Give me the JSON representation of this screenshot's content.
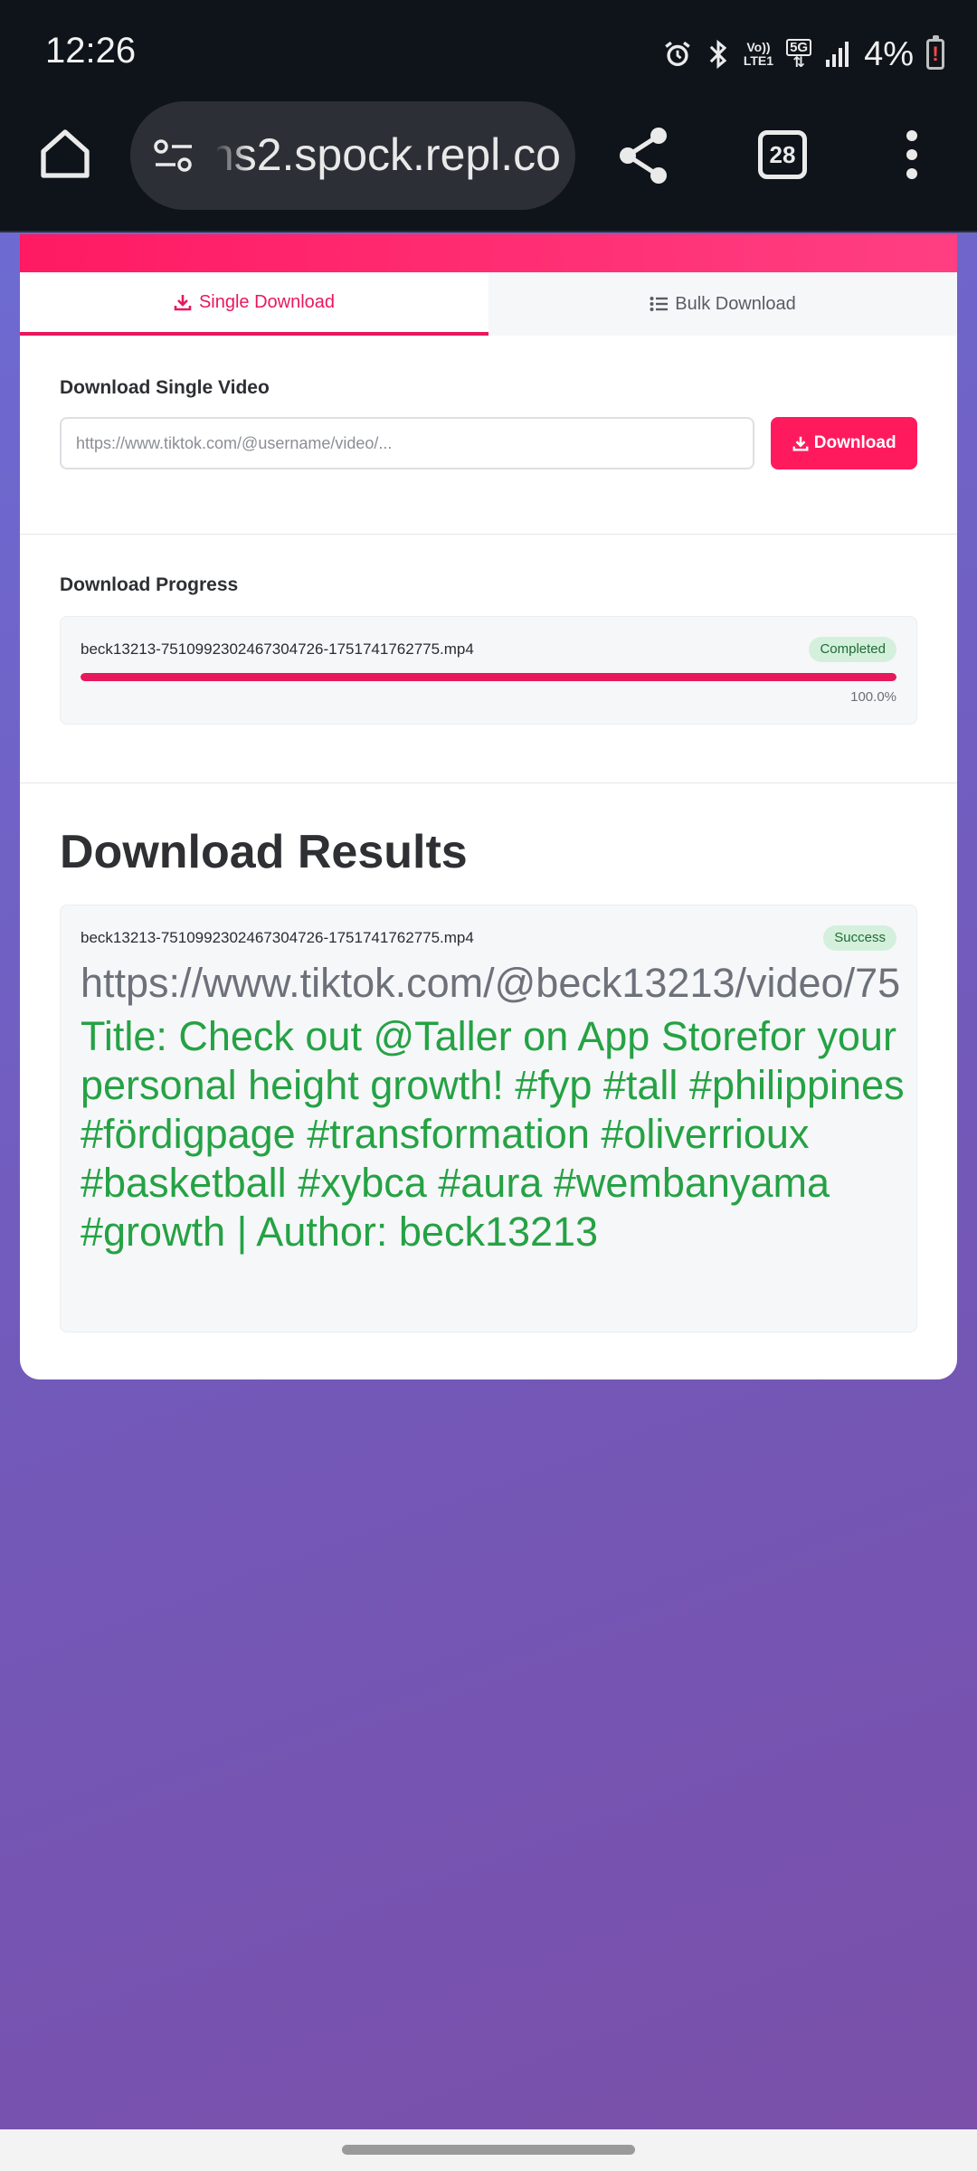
{
  "status_bar": {
    "time": "12:26",
    "network_label_top": "Vo))",
    "network_label_bottom": "LTE1",
    "network_5g": "5G",
    "battery_percent": "4%"
  },
  "browser": {
    "url_text": "ns2.spock.repl.co",
    "tab_count": "28"
  },
  "tabs": [
    {
      "label": "Single Download",
      "active": true
    },
    {
      "label": "Bulk Download",
      "active": false
    }
  ],
  "single": {
    "title": "Download Single Video",
    "input_value": "",
    "input_placeholder": "https://www.tiktok.com/@username/video/...",
    "button_label": "Download"
  },
  "progress": {
    "title": "Download Progress",
    "items": [
      {
        "filename": "beck13213-7510992302467304726-1751741762775.mp4",
        "status": "Completed",
        "percent_text": "100.0%",
        "fraction": 1.0
      }
    ]
  },
  "results": {
    "title": "Download Results",
    "items": [
      {
        "filename": "beck13213-7510992302467304726-1751741762775.mp4",
        "status": "Success",
        "url": "https://www.tiktok.com/@beck13213/video/75",
        "meta": "Title: Check out @Taller on App Storefor your personal height growth! #fyp #tall #philippines #fördigpage #transformation #oliverrioux #basketball #xybca #aura #wembanyama #growth | Author: beck13213"
      }
    ]
  },
  "colors": {
    "accent": "#e8185c",
    "success": "#25a244",
    "background_start": "#6c6ed6",
    "background_end": "#7a4fa8"
  }
}
